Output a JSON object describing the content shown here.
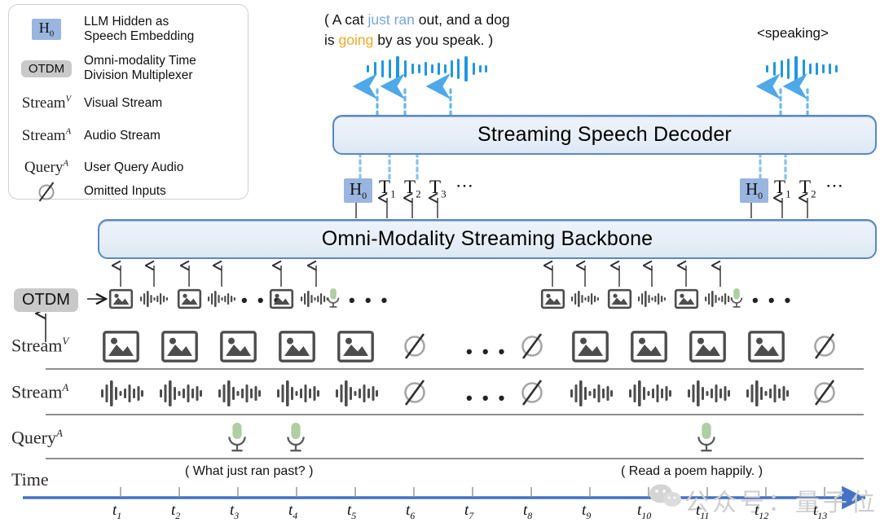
{
  "legend": {
    "items": [
      {
        "symbol_kind": "h0-chip",
        "symbol": "H0",
        "label": "LLM Hidden as\nSpeech Embedding",
        "label_line1": "LLM Hidden as",
        "label_line2": "Speech Embedding"
      },
      {
        "symbol_kind": "otdm-chip",
        "symbol": "OTDM",
        "label_line1": "Omni-modality Time",
        "label_line2": "Division Multiplexer"
      },
      {
        "symbol_kind": "math",
        "symbol": "Stream",
        "sup": "V",
        "label_line1": "Visual Stream",
        "label_line2": ""
      },
      {
        "symbol_kind": "math",
        "symbol": "Stream",
        "sup": "A",
        "label_line1": "Audio Stream",
        "label_line2": ""
      },
      {
        "symbol_kind": "math",
        "symbol": "Query",
        "sup": "A",
        "label_line1": "User Query Audio",
        "label_line2": ""
      },
      {
        "symbol_kind": "null",
        "symbol": "Ø",
        "label_line1": "Omitted Inputs",
        "label_line2": ""
      }
    ]
  },
  "speech_output": {
    "left_caption": {
      "line1_pre": "( A cat ",
      "line1_hl": "just ran",
      "line1_post": " out, and a dog",
      "line2_pre": "is ",
      "line2_hl": "going",
      "line2_post": " by as you speak. )"
    },
    "right_caption": "<speaking>"
  },
  "boxes": {
    "decoder": "Streaming Speech Decoder",
    "backbone": "Omni-Modality Streaming Backbone"
  },
  "tokens": {
    "left": {
      "hidden": "H",
      "hidden_sub": "0",
      "t": [
        "T1",
        "T2",
        "T3"
      ],
      "ellipsis": "⋯"
    },
    "right": {
      "hidden": "H",
      "hidden_sub": "0",
      "t": [
        "T1",
        "T2"
      ],
      "ellipsis": "⋯"
    }
  },
  "otdm": {
    "chip": "OTDM",
    "left_group": [
      "image",
      "audio",
      "image",
      "audio"
    ],
    "left_dots": "• • •",
    "mid_group": [
      "image",
      "audio+mic"
    ],
    "mid_dots": "• • •",
    "right_group": [
      "image",
      "audio",
      "image",
      "audio",
      "image",
      "audio+mic"
    ],
    "right_dots": "• • •"
  },
  "rows": {
    "stream_v": {
      "label": "Stream",
      "sup": "V"
    },
    "stream_a": {
      "label": "Stream",
      "sup": "A"
    },
    "query_a": {
      "label": "Query",
      "sup": "A"
    },
    "time": {
      "label": "Time"
    }
  },
  "timeline": {
    "ticks": [
      "t1",
      "t2",
      "t3",
      "t4",
      "t5",
      "t6",
      "t7",
      "t8",
      "t9",
      "t10",
      "t11",
      "t12",
      "t13"
    ],
    "tick_base": "t",
    "tick_subs": [
      "1",
      "2",
      "3",
      "4",
      "5",
      "6",
      "7",
      "8",
      "9",
      "10",
      "11",
      "12",
      "13"
    ],
    "ellipsis": "⋯"
  },
  "queries": {
    "first": "( What just ran past? )",
    "second": "( Read a poem happily. )"
  },
  "watermark": "公众号：量子位",
  "colors": {
    "accent_blue": "#5b87c4",
    "token_highlight": "#9ab6e0",
    "waveform_blue": "#2196e3",
    "mic_green": "#aecfa2",
    "chip_grey": "#c9c9c9",
    "caption_blue": "#79a5dd",
    "caption_gold": "#f0a92a",
    "timeline_blue": "#4472c4"
  }
}
